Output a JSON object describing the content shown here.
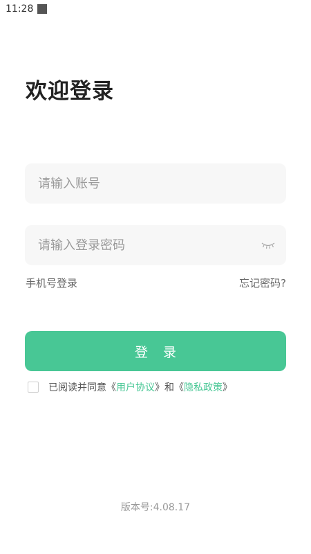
{
  "status_bar": {
    "time": "11:28"
  },
  "title": "欢迎登录",
  "account": {
    "placeholder": "请输入账号",
    "value": ""
  },
  "password": {
    "placeholder": "请输入登录密码",
    "value": ""
  },
  "links": {
    "phone_login": "手机号登录",
    "forgot": "忘记密码?"
  },
  "login_button": "登 录",
  "agreement": {
    "prefix": "已阅读并同意",
    "open1": "《",
    "user_agreement": "用户协议",
    "close1": "》",
    "and": "和",
    "open2": "《",
    "privacy": "隐私政策",
    "close2": "》",
    "checked": false
  },
  "version": "版本号:4.08.17",
  "colors": {
    "accent": "#48c795",
    "field_bg": "#f7f7f7"
  },
  "icons": {
    "password_toggle": "eye-closed-icon"
  }
}
